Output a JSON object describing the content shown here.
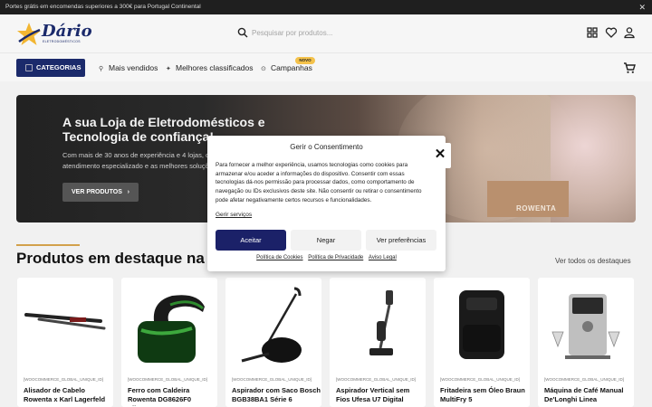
{
  "topbar": {
    "promo": "Portes grátis em encomendas superiores a 300€ para Portugal Continental",
    "close_glyph": "✕"
  },
  "header": {
    "logo_text": "Dário",
    "logo_subtext": "ELETRODOMÉSTICOS",
    "search_placeholder": "Pesquisar por produtos...",
    "icons": [
      "compare-icon",
      "heart-icon",
      "user-icon"
    ]
  },
  "nav": {
    "categories_label": "CATEGORIAS",
    "links": [
      {
        "label": "Mais vendidos",
        "icon": "trending-icon"
      },
      {
        "label": "Melhores classificados",
        "icon": "medal-icon"
      },
      {
        "label": "Campanhas",
        "icon": "tag-icon"
      }
    ],
    "badge": "NOVO",
    "cart_icon": "cart-icon"
  },
  "hero": {
    "title": "A sua Loja de Eletrodomésticos e Tecnologia de confiança!",
    "text": "Com mais de 30 anos de experiência e 4 lojas, oferecemos atendimento especializado e as melhores soluções.",
    "button": "VER PRODUTOS",
    "brand": "ROWENTA"
  },
  "section": {
    "title": "Produtos em destaque na Dário",
    "link": "Ver todos os destaques"
  },
  "products": [
    {
      "sku": "[WOOCOMMERCE_GLOBAL_UNIQUE_ID]",
      "name": "Alisador de Cabelo Rowenta x Karl Lagerfeld"
    },
    {
      "sku": "[WOOCOMMERCE_GLOBAL_UNIQUE_ID]",
      "name": "Ferro com Caldeira Rowenta DG8626F0 Silence"
    },
    {
      "sku": "[WOOCOMMERCE_GLOBAL_UNIQUE_ID]",
      "name": "Aspirador com Saco Bosch BGB38BA1 Série 6"
    },
    {
      "sku": "[WOOCOMMERCE_GLOBAL_UNIQUE_ID]",
      "name": "Aspirador Vertical sem Fios Ufesa U7 Digital"
    },
    {
      "sku": "[WOOCOMMERCE_GLOBAL_UNIQUE_ID]",
      "name": "Fritadeira sem Óleo Braun MultiFry 5"
    },
    {
      "sku": "[WOOCOMMERCE_GLOBAL_UNIQUE_ID]",
      "name": "Máquina de Café Manual De'Longhi Linea"
    }
  ],
  "consent": {
    "title": "Gerir o Consentimento",
    "body": "Para fornecer a melhor experiência, usamos tecnologias como cookies para armazenar e/ou aceder a informações do dispositivo. Consentir com essas tecnologias dá-nos permissão para processar dados, como comportamento de navegação ou IDs exclusivos deste site. Não consentir ou retirar o consentimento pode afetar negativamente certos recursos e funcionalidades.",
    "services_link": "Gerir serviços",
    "accept": "Aceitar",
    "deny": "Negar",
    "preferences": "Ver preferências",
    "links": [
      "Política de Cookies",
      "Política de Privacidade",
      "Aviso Legal"
    ],
    "close_glyph": "✕"
  },
  "colors": {
    "brand_navy": "#1b2a6b",
    "accept_button": "#1b2168",
    "accent_gold": "#d2a14b",
    "badge_yellow": "#f4c24b"
  }
}
